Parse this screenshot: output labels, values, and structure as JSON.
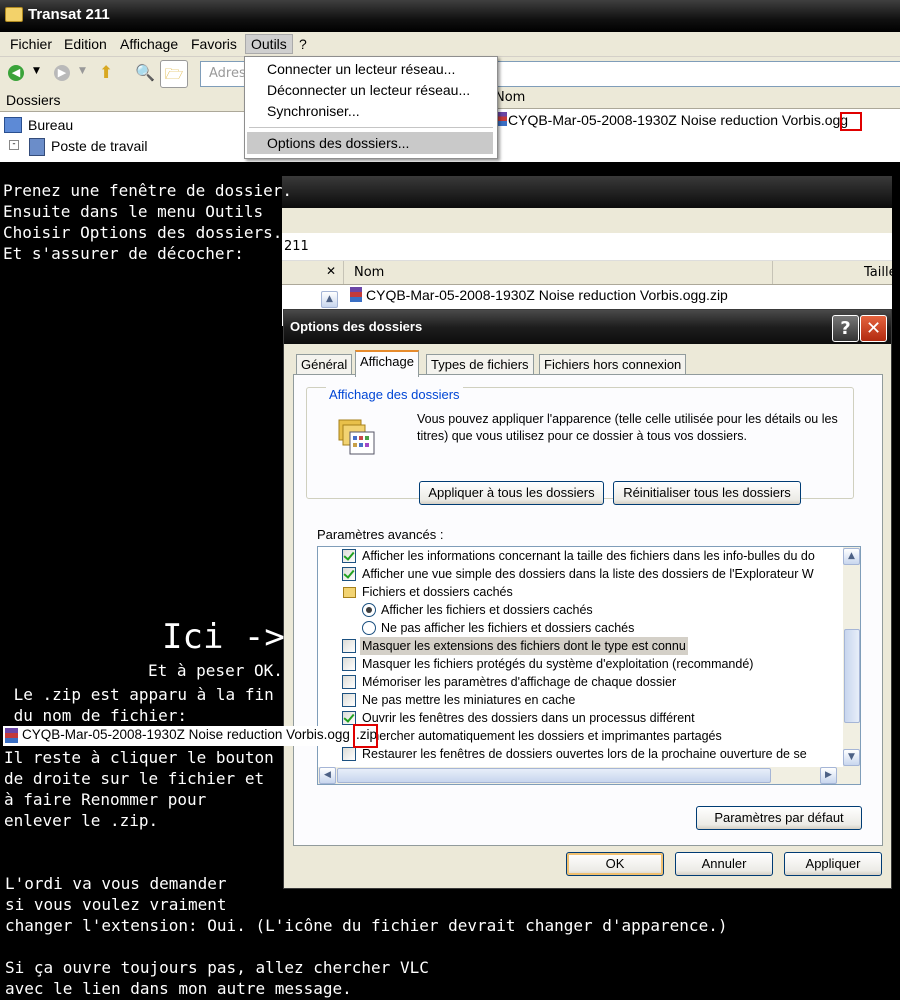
{
  "top_window": {
    "title": "Transat 211",
    "menu": [
      "Fichier",
      "Edition",
      "Affichage",
      "Favoris",
      "Outils",
      "?"
    ],
    "address_label": "Adres",
    "folders_header": "Dossiers",
    "tree": [
      "Bureau",
      "Poste de travail"
    ],
    "column_name": "Nom",
    "file": "CYQB-Mar-05-2008-1930Z Noise reduction Vorbis.ogg"
  },
  "outils_menu": {
    "items": [
      "Connecter un lecteur réseau...",
      "Déconnecter un lecteur réseau...",
      "Synchroniser...",
      "Options des dossiers..."
    ]
  },
  "mid_window": {
    "address_fragment": "211",
    "column_close": "✕",
    "column_name": "Nom",
    "column_size": "Taille",
    "file": "CYQB-Mar-05-2008-1930Z Noise reduction Vorbis.ogg.zip"
  },
  "dialog": {
    "title": "Options des dossiers",
    "help_btn": "?",
    "close_btn": "✕",
    "tabs": [
      "Général",
      "Affichage",
      "Types de fichiers",
      "Fichiers hors connexion"
    ],
    "group_title": "Affichage des dossiers",
    "group_text": "Vous pouvez appliquer l'apparence (telle celle utilisée pour les détails ou les titres) que vous utilisez pour ce dossier à tous vos dossiers.",
    "btn_apply_all": "Appliquer à tous les dossiers",
    "btn_reset_all": "Réinitialiser tous les dossiers",
    "advanced_label": "Paramètres avancés :",
    "settings": [
      "Afficher les informations concernant la taille des fichiers dans les info-bulles du do",
      "Afficher une vue simple des dossiers dans la liste des dossiers de l'Explorateur W",
      "Fichiers et dossiers cachés",
      "Afficher les fichiers et dossiers cachés",
      "Ne pas afficher les fichiers et dossiers cachés",
      "Masquer les extensions des fichiers dont le type est connu",
      "Masquer les fichiers protégés du système d'exploitation (recommandé)",
      "Mémoriser les paramètres d'affichage de chaque dossier",
      "Ne pas mettre les miniatures en cache",
      "Ouvrir les fenêtres des dossiers dans un processus différent",
      "chercher automatiquement les dossiers et imprimantes partagés",
      "Restaurer les fenêtres de dossiers ouvertes lors de la prochaine ouverture de se"
    ],
    "btn_defaults": "Paramètres par défaut",
    "btn_ok": "OK",
    "btn_cancel": "Annuler",
    "btn_apply": "Appliquer"
  },
  "tutorial": {
    "intro": "Prenez une fenêtre de dossier.\nEnsuite dans le menu Outils\nChoisir Options des dossiers...\nEt s'assurer de décocher:",
    "ici": "Ici ->",
    "peser": "Et à peser OK.",
    "zip_appeared": " Le .zip est apparu à la fin\n du nom de fichier:",
    "file_shown": "CYQB-Mar-05-2008-1930Z Noise reduction Vorbis.ogg",
    "file_ext": ".zip",
    "rename": "Il reste à cliquer le bouton\nde droite sur le fichier et\nà faire Renommer pour\nenlever le .zip.",
    "confirm": "L'ordi va vous demander\nsi vous voulez vraiment\nchanger l'extension: Oui. (L'icône du fichier devrait changer d'apparence.)",
    "vlc": "Si ça ouvre toujours pas, allez chercher VLC\navec le lien dans mon autre message."
  }
}
